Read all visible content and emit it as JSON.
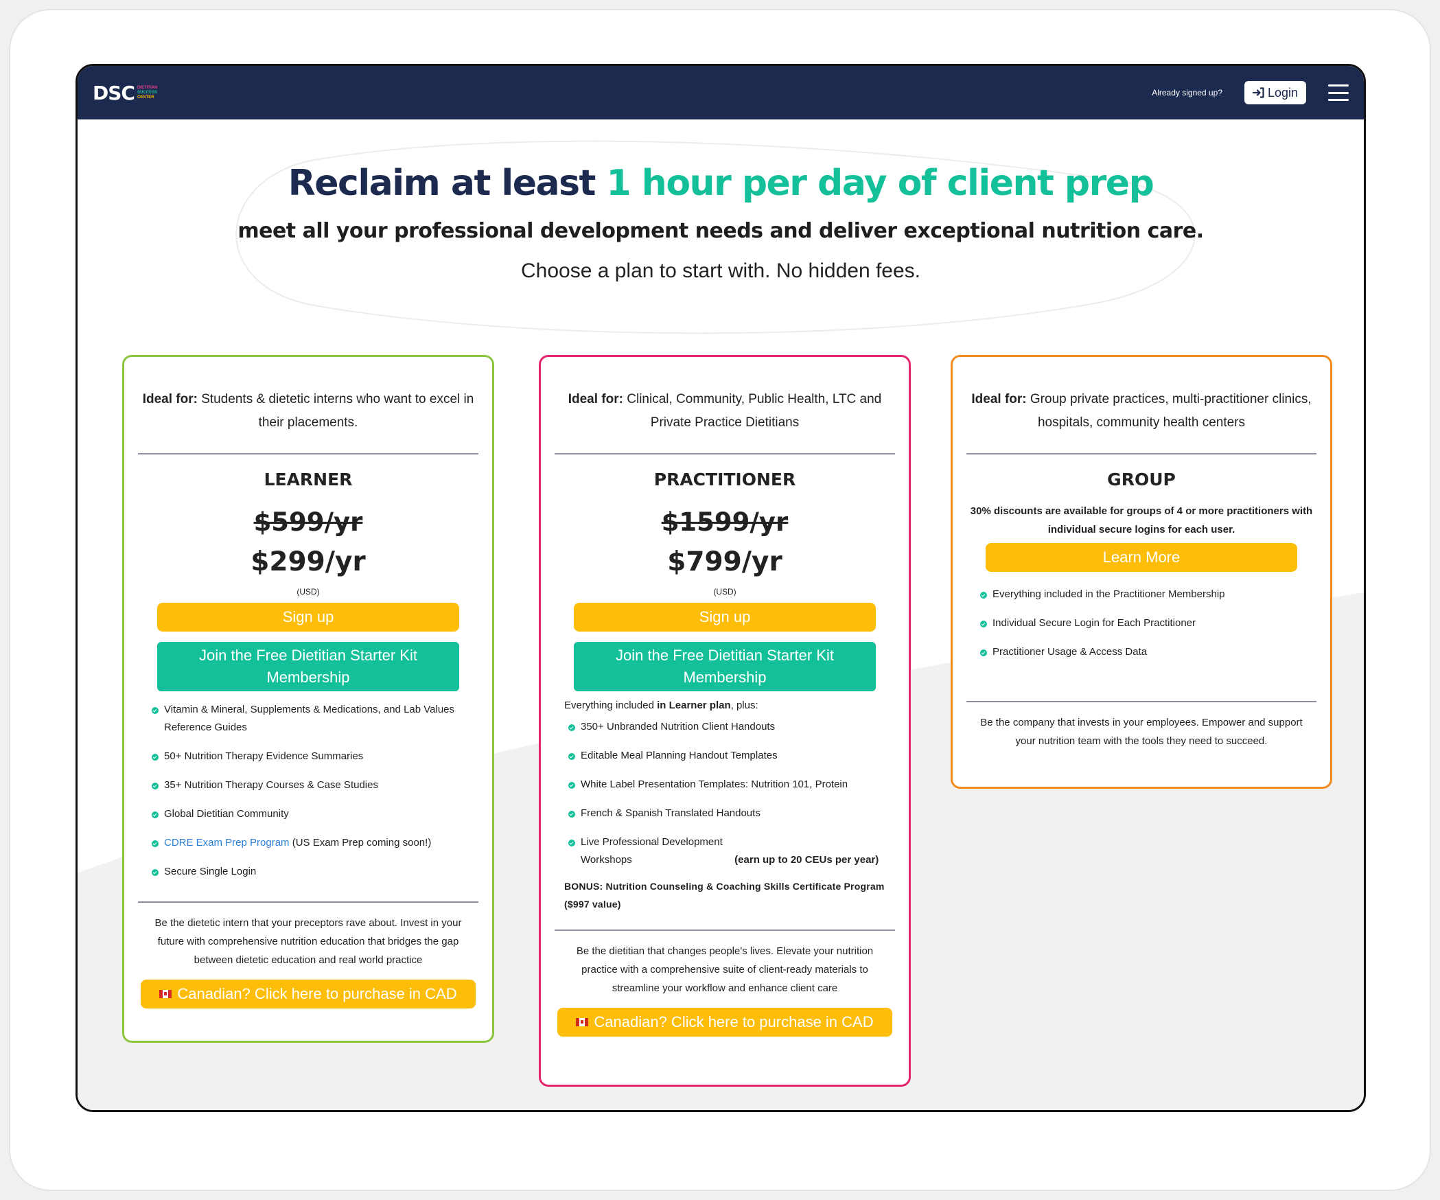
{
  "nav": {
    "logo_main": "DSC",
    "logo_sub": [
      "DIETITIAN",
      "SUCCESS",
      "CENTER"
    ],
    "signed_up_text": "Already signed up?",
    "login_label": "Login",
    "login_icon": "sign-in-icon",
    "menu_icon": "hamburger-menu-icon"
  },
  "hero": {
    "title_part1": "Reclaim at least",
    "title_part2": "1 hour per day of client prep",
    "subtitle": "meet all your professional development needs and deliver exceptional nutrition care.",
    "choose": "Choose a plan to start with. No hidden fees."
  },
  "colors": {
    "navy": "#1b2a4e",
    "accent_green": "#14c09a",
    "yellow": "#fdbd08",
    "learner_border": "#8cc63f",
    "practitioner_border": "#e6246e",
    "group_border": "#f28c1e"
  },
  "learner": {
    "ideal_label": "Ideal for:",
    "ideal_text": "Students & dietetic interns who want to excel in their placements.",
    "name": "LEARNER",
    "price_old": "$599/yr",
    "price_new": "$299/yr",
    "currency": "(USD)",
    "signup_label": "Sign up",
    "starter_label": "Join the Free Dietitian Starter Kit Membership",
    "features": [
      "Vitamin & Mineral, Supplements & Medications, and Lab Values Reference Guides",
      "50+ Nutrition Therapy Evidence Summaries",
      "35+ Nutrition Therapy Courses & Case Studies",
      "Global Dietitian Community",
      "Secure Single Login"
    ],
    "cdre_link": "CDRE Exam Prep Program",
    "cdre_rest": "(US Exam Prep coming soon!)",
    "tagline": "Be the dietetic intern that your preceptors rave about. Invest in your future with comprehensive nutrition education that bridges the gap between dietetic education and real world practice",
    "cad_label": "Canadian? Click here to purchase in CAD"
  },
  "practitioner": {
    "ideal_label": "Ideal for:",
    "ideal_text": "Clinical, Community, Public Health, LTC and Private Practice Dietitians",
    "name": "PRACTITIONER",
    "price_old": "$1599/yr",
    "price_new": "$799/yr",
    "currency": "(USD)",
    "signup_label": "Sign up",
    "starter_label": "Join the Free Dietitian Starter Kit Membership",
    "plus_prefix": "Everything included",
    "plus_bold": "in Learner plan",
    "plus_suffix": ", plus:",
    "features": [
      "350+ Unbranded Nutrition Client Handouts",
      "Editable Meal Planning Handout Templates",
      "White Label Presentation Templates: Nutrition 101, Protein",
      "French & Spanish Translated Handouts"
    ],
    "workshop_text": "Live Professional Development Workshops",
    "workshop_bold": "(earn up to 20 CEUs per year)",
    "bonus": "BONUS: Nutrition Counseling & Coaching Skills Certificate Program ($997 value)",
    "tagline": "Be the dietitian that changes people's lives. Elevate your nutrition practice with a comprehensive suite of client-ready materials to streamline your workflow and enhance client care",
    "cad_label": "Canadian? Click here to purchase in CAD"
  },
  "group": {
    "ideal_label": "Ideal for:",
    "ideal_text": "Group private practices, multi-practitioner clinics, hospitals, community health centers",
    "name": "GROUP",
    "note": "30% discounts are available for groups of 4 or more practitioners with individual secure logins for each user.",
    "learn_more_label": "Learn More",
    "features": [
      "Everything included in the Practitioner Membership",
      "Individual Secure Login for Each Practitioner",
      "Practitioner Usage & Access Data"
    ],
    "tagline": "Be the company that invests in your employees. Empower and support your nutrition team with the tools they need to succeed."
  }
}
